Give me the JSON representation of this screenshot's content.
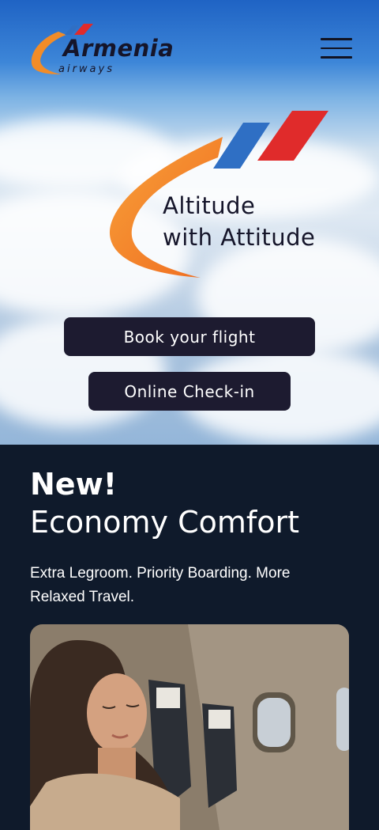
{
  "brand": {
    "name": "Armenia",
    "subtitle": "airways",
    "colors": {
      "orange": "#f28c28",
      "blue": "#2f6fc4",
      "red": "#e02b2b",
      "navy": "#1d1b30"
    }
  },
  "header": {
    "menu_icon": "hamburger-menu-icon"
  },
  "hero": {
    "tagline_line1": "Altitude",
    "tagline_line2": "with Attitude",
    "buttons": {
      "book": "Book your flight",
      "checkin": "Online Check-in"
    }
  },
  "promo": {
    "title_line1": "New!",
    "title_line2": "Economy Comfort",
    "description": "Extra Legroom. Priority Boarding. More Relaxed Travel.",
    "image_subject": "woman resting in airplane economy comfort seat"
  }
}
